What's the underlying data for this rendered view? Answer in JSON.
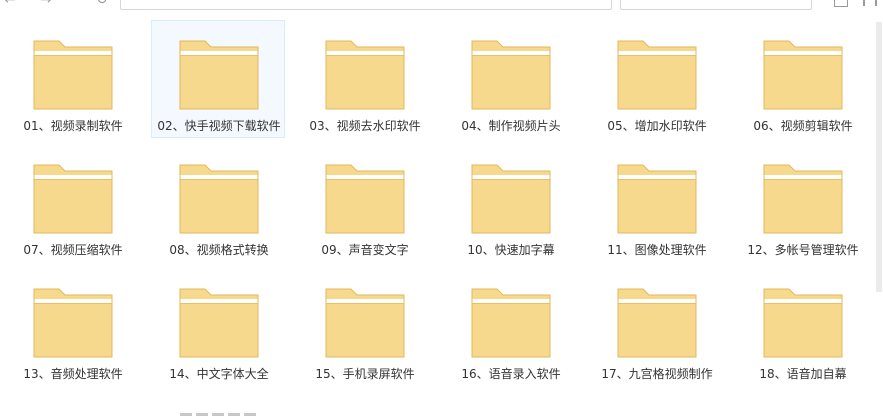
{
  "folders": [
    {
      "label": "01、视频录制软件"
    },
    {
      "label": "02、快手视频下载软件",
      "selected": true
    },
    {
      "label": "03、视频去水印软件"
    },
    {
      "label": "04、制作视频片头"
    },
    {
      "label": "05、增加水印软件"
    },
    {
      "label": "06、视频剪辑软件"
    },
    {
      "label": "07、视频压缩软件"
    },
    {
      "label": "08、视频格式转换"
    },
    {
      "label": "09、声音变文字"
    },
    {
      "label": "10、快速加字幕"
    },
    {
      "label": "11、图像处理软件"
    },
    {
      "label": "12、多帐号管理软件"
    },
    {
      "label": "13、音频处理软件"
    },
    {
      "label": "14、中文字体大全"
    },
    {
      "label": "15、手机录屏软件"
    },
    {
      "label": "16、语音录入软件"
    },
    {
      "label": "17、九宫格视频制作"
    },
    {
      "label": "18、语音加自幕"
    }
  ],
  "colors": {
    "folder_body": "#f7d98e",
    "folder_edge": "#e2b85c",
    "folder_paper": "#ffffff",
    "selection_bg": "#f3f9fe",
    "selection_border": "#d9ecfb"
  },
  "icons": {
    "folder": "folder-icon",
    "back": "back-arrow-icon",
    "forward": "forward-arrow-icon"
  }
}
